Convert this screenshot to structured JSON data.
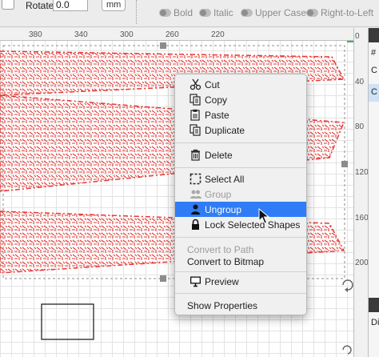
{
  "toolbar": {
    "rotate_label": "Rotate",
    "rotate_value": "0.0",
    "unit": "mm",
    "toggles": [
      {
        "label": "Bold"
      },
      {
        "label": "Italic"
      },
      {
        "label": "Upper Case"
      },
      {
        "label": "Right-to-Left"
      }
    ]
  },
  "ruler": {
    "h_ticks": [
      "380",
      "340",
      "300",
      "260",
      "220"
    ],
    "v_ticks": [
      "0",
      "40",
      "80",
      "120",
      "160",
      "200"
    ]
  },
  "right_panel": {
    "items": [
      "#",
      "C",
      "C"
    ],
    "bottom_label": "Di"
  },
  "menu": {
    "cut": "Cut",
    "copy": "Copy",
    "paste": "Paste",
    "duplicate": "Duplicate",
    "delete": "Delete",
    "select_all": "Select All",
    "group": "Group",
    "ungroup": "Ungroup",
    "lock": "Lock Selected Shapes",
    "convert_path": "Convert to Path",
    "convert_bitmap": "Convert to Bitmap",
    "preview": "Preview",
    "show_properties": "Show Properties"
  },
  "colors": {
    "shape_stroke": "#e53935",
    "highlight": "#2f7cf6",
    "selection_handle": "#8c8c8c",
    "corner_handle": "#3bb54a"
  }
}
